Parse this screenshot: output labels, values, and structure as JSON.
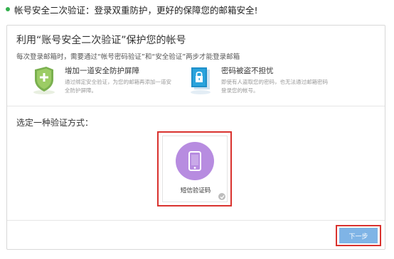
{
  "notice": {
    "text": "帐号安全二次验证：登录双重防护，更好的保障您的邮箱安全!",
    "dot_color": "#33b04d"
  },
  "panel": {
    "title": "利用“账号安全二次验证”保护您的帐号",
    "subtitle": "每次登录邮箱时，需要通过“帐号密码验证”和“安全验证”两步才能登录邮箱",
    "benefits": [
      {
        "icon": "shield-plus-icon",
        "title": "增加一道安全防护屏障",
        "desc": "通过绑定安全验证，为您的邮箱再添加一道安全防护屏障。"
      },
      {
        "icon": "lock-file-icon",
        "title": "密码被盗不担忧",
        "desc": "即使有人盗取您的密码，也无法通过邮箱密码登录您的帐号。"
      }
    ],
    "choose_label": "选定一种验证方式：",
    "methods": [
      {
        "icon": "mobile-phone-icon",
        "label": "短信验证码",
        "selected": true
      }
    ],
    "next_label": "下一步"
  },
  "colors": {
    "accent_purple": "#b78ce0",
    "button_blue": "#7fb4e6",
    "highlight_red": "#d9322e",
    "shield_green": "#6aa84f"
  }
}
